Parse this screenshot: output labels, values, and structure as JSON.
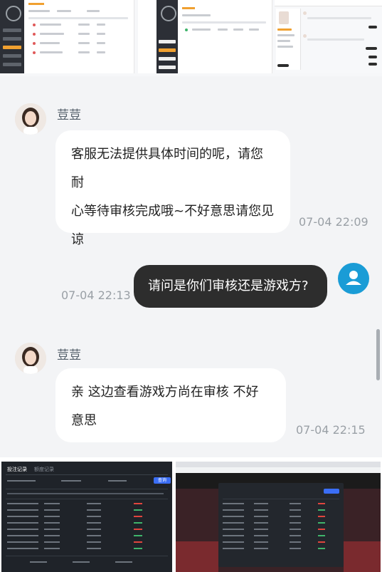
{
  "messages": [
    {
      "sender": "荳荳",
      "text_line1": "客服无法提供具体时间的呢，请您耐",
      "text_line2": "心等待审核完成哦~不好意思请您见",
      "text_line3": "谅",
      "time": "07-04 22:09"
    },
    {
      "text": "请问是你们审核还是游戏方?",
      "time": "07-04 22:13"
    },
    {
      "sender": "荳荳",
      "text_line1": "亲  这边查看游戏方尚在审核  不好",
      "text_line2": "意思",
      "time": "07-04 22:15"
    }
  ],
  "bottom_left": {
    "tab1": "投注记录",
    "tab2": "额度记录",
    "button": "查询"
  },
  "colors": {
    "chat_bg": "#f3f4f6",
    "bubble_out": "#2d2d2d",
    "user_avatar": "#1a9cd6",
    "time": "#9aa0a6"
  },
  "icons": {
    "user_avatar": "person-icon"
  }
}
